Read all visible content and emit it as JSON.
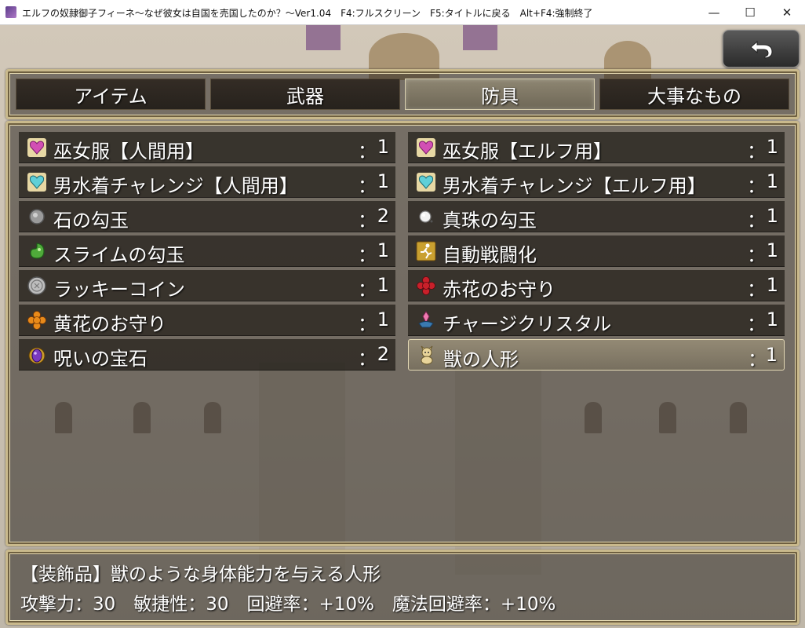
{
  "window": {
    "title": "エルフの奴隷御子フィーネ～なぜ彼女は自国を売国したのか？～Ver1.04　F4:フルスクリーン　F5:タイトルに戻る　Alt+F4:強制終了",
    "minimize_label": "—",
    "maximize_label": "☐",
    "close_label": "✕"
  },
  "tabs": [
    {
      "label": "アイテム",
      "active": false
    },
    {
      "label": "武器",
      "active": false
    },
    {
      "label": "防具",
      "active": true
    },
    {
      "label": "大事なもの",
      "active": false
    }
  ],
  "colon": "：",
  "items": [
    {
      "name": "巫女服【人間用】",
      "count": "1",
      "icon": "pink-heart-icon"
    },
    {
      "name": "巫女服【エルフ用】",
      "count": "1",
      "icon": "pink-heart-icon"
    },
    {
      "name": "男水着チャレンジ【人間用】",
      "count": "1",
      "icon": "cyan-heart-icon"
    },
    {
      "name": "男水着チャレンジ【エルフ用】",
      "count": "1",
      "icon": "cyan-heart-icon"
    },
    {
      "name": "石の勾玉",
      "count": "2",
      "icon": "stone-magatama-icon"
    },
    {
      "name": "真珠の勾玉",
      "count": "1",
      "icon": "pearl-magatama-icon"
    },
    {
      "name": "スライムの勾玉",
      "count": "1",
      "icon": "slime-magatama-icon"
    },
    {
      "name": "自動戦闘化",
      "count": "1",
      "icon": "auto-battle-icon"
    },
    {
      "name": "ラッキーコイン",
      "count": "1",
      "icon": "coin-icon"
    },
    {
      "name": "赤花のお守り",
      "count": "1",
      "icon": "red-flower-icon"
    },
    {
      "name": "黄花のお守り",
      "count": "1",
      "icon": "yellow-flower-icon"
    },
    {
      "name": "チャージクリスタル",
      "count": "1",
      "icon": "crystal-icon"
    },
    {
      "name": "呪いの宝石",
      "count": "2",
      "icon": "cursed-gem-icon"
    },
    {
      "name": "獣の人形",
      "count": "1",
      "icon": "beast-doll-icon",
      "selected": true
    }
  ],
  "help": {
    "line1": "【装飾品】獣のような身体能力を与える人形",
    "line2": "攻撃力：30　敏捷性：30　回避率：+10%　魔法回避率：+10%"
  },
  "colors": {
    "panel_border": "#c9b98c",
    "selected_bg": "#8e8672"
  }
}
